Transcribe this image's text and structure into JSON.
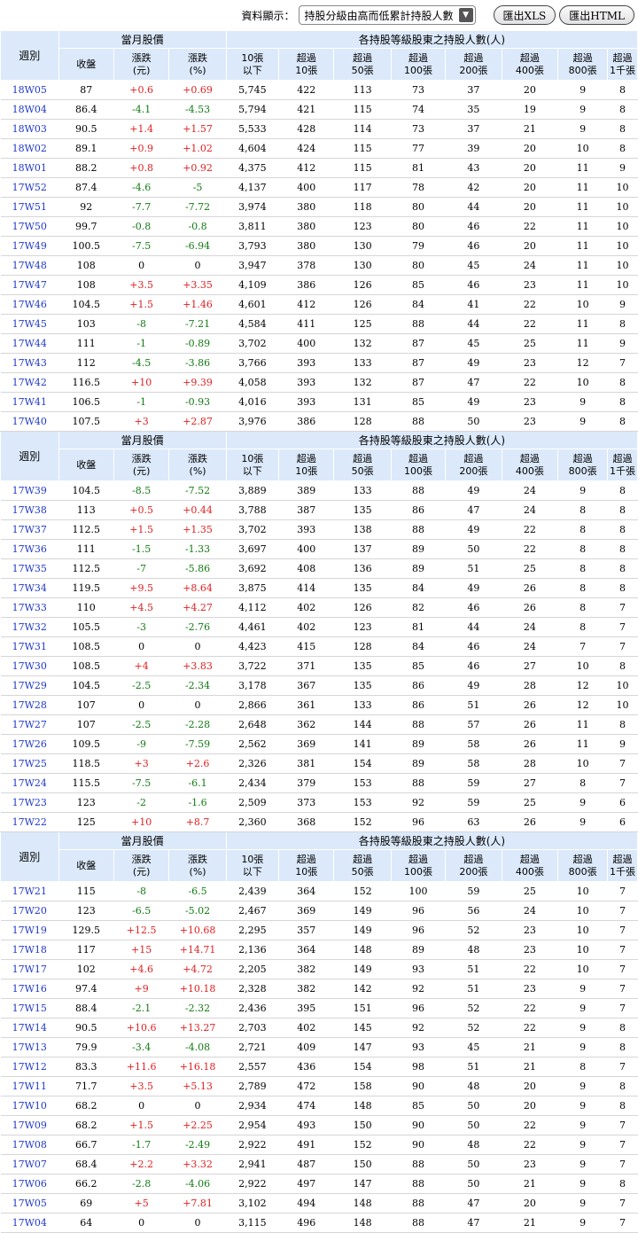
{
  "toolbar": {
    "display_label": "資料顯示：",
    "select_value": "持股分級由高而低累計持股人數",
    "export_xls": "匯出XLS",
    "export_html": "匯出HTML"
  },
  "header": {
    "week": "週別",
    "price_group": "當月股價",
    "holders_group": "各持股等級股東之持股人數(人)",
    "columns": [
      "收盤",
      "漲跌\n(元)",
      "漲跌\n(%)",
      "10張\n以下",
      "超過\n10張",
      "超過\n50張",
      "超過\n100張",
      "超過\n200張",
      "超過\n400張",
      "超過\n800張",
      "超過\n1千張"
    ]
  },
  "sections": [
    {
      "rows": [
        [
          "18W05",
          "87",
          "+0.6",
          "+0.69",
          "5,745",
          "422",
          "113",
          "73",
          "37",
          "20",
          "9",
          "8"
        ],
        [
          "18W04",
          "86.4",
          "-4.1",
          "-4.53",
          "5,794",
          "421",
          "115",
          "74",
          "35",
          "19",
          "9",
          "8"
        ],
        [
          "18W03",
          "90.5",
          "+1.4",
          "+1.57",
          "5,533",
          "428",
          "114",
          "73",
          "37",
          "21",
          "9",
          "8"
        ],
        [
          "18W02",
          "89.1",
          "+0.9",
          "+1.02",
          "4,604",
          "424",
          "115",
          "77",
          "39",
          "20",
          "10",
          "8"
        ],
        [
          "18W01",
          "88.2",
          "+0.8",
          "+0.92",
          "4,375",
          "412",
          "115",
          "81",
          "43",
          "20",
          "11",
          "9"
        ],
        [
          "17W52",
          "87.4",
          "-4.6",
          "-5",
          "4,137",
          "400",
          "117",
          "78",
          "42",
          "20",
          "11",
          "10"
        ],
        [
          "17W51",
          "92",
          "-7.7",
          "-7.72",
          "3,974",
          "380",
          "118",
          "80",
          "44",
          "20",
          "11",
          "10"
        ],
        [
          "17W50",
          "99.7",
          "-0.8",
          "-0.8",
          "3,811",
          "380",
          "123",
          "80",
          "46",
          "22",
          "11",
          "10"
        ],
        [
          "17W49",
          "100.5",
          "-7.5",
          "-6.94",
          "3,793",
          "380",
          "130",
          "79",
          "46",
          "20",
          "11",
          "10"
        ],
        [
          "17W48",
          "108",
          "0",
          "0",
          "3,947",
          "378",
          "130",
          "80",
          "45",
          "24",
          "11",
          "10"
        ],
        [
          "17W47",
          "108",
          "+3.5",
          "+3.35",
          "4,109",
          "386",
          "126",
          "85",
          "46",
          "23",
          "11",
          "10"
        ],
        [
          "17W46",
          "104.5",
          "+1.5",
          "+1.46",
          "4,601",
          "412",
          "126",
          "84",
          "41",
          "22",
          "10",
          "9"
        ],
        [
          "17W45",
          "103",
          "-8",
          "-7.21",
          "4,584",
          "411",
          "125",
          "88",
          "44",
          "22",
          "11",
          "8"
        ],
        [
          "17W44",
          "111",
          "-1",
          "-0.89",
          "3,702",
          "400",
          "132",
          "87",
          "45",
          "25",
          "11",
          "9"
        ],
        [
          "17W43",
          "112",
          "-4.5",
          "-3.86",
          "3,766",
          "393",
          "133",
          "87",
          "49",
          "23",
          "12",
          "7"
        ],
        [
          "17W42",
          "116.5",
          "+10",
          "+9.39",
          "4,058",
          "393",
          "132",
          "87",
          "47",
          "22",
          "10",
          "8"
        ],
        [
          "17W41",
          "106.5",
          "-1",
          "-0.93",
          "4,016",
          "393",
          "131",
          "85",
          "49",
          "23",
          "9",
          "8"
        ],
        [
          "17W40",
          "107.5",
          "+3",
          "+2.87",
          "3,976",
          "386",
          "128",
          "88",
          "50",
          "23",
          "9",
          "8"
        ]
      ]
    },
    {
      "rows": [
        [
          "17W39",
          "104.5",
          "-8.5",
          "-7.52",
          "3,889",
          "389",
          "133",
          "88",
          "49",
          "24",
          "9",
          "8"
        ],
        [
          "17W38",
          "113",
          "+0.5",
          "+0.44",
          "3,788",
          "387",
          "135",
          "86",
          "47",
          "24",
          "8",
          "8"
        ],
        [
          "17W37",
          "112.5",
          "+1.5",
          "+1.35",
          "3,702",
          "393",
          "138",
          "88",
          "49",
          "22",
          "8",
          "8"
        ],
        [
          "17W36",
          "111",
          "-1.5",
          "-1.33",
          "3,697",
          "400",
          "137",
          "89",
          "50",
          "22",
          "8",
          "8"
        ],
        [
          "17W35",
          "112.5",
          "-7",
          "-5.86",
          "3,692",
          "408",
          "136",
          "89",
          "51",
          "25",
          "8",
          "8"
        ],
        [
          "17W34",
          "119.5",
          "+9.5",
          "+8.64",
          "3,875",
          "414",
          "135",
          "84",
          "49",
          "26",
          "8",
          "8"
        ],
        [
          "17W33",
          "110",
          "+4.5",
          "+4.27",
          "4,112",
          "402",
          "126",
          "82",
          "46",
          "26",
          "8",
          "7"
        ],
        [
          "17W32",
          "105.5",
          "-3",
          "-2.76",
          "4,461",
          "402",
          "123",
          "81",
          "44",
          "24",
          "8",
          "7"
        ],
        [
          "17W31",
          "108.5",
          "0",
          "0",
          "4,423",
          "415",
          "128",
          "84",
          "46",
          "24",
          "7",
          "7"
        ],
        [
          "17W30",
          "108.5",
          "+4",
          "+3.83",
          "3,722",
          "371",
          "135",
          "85",
          "46",
          "27",
          "10",
          "8"
        ],
        [
          "17W29",
          "104.5",
          "-2.5",
          "-2.34",
          "3,178",
          "367",
          "135",
          "86",
          "49",
          "28",
          "12",
          "10"
        ],
        [
          "17W28",
          "107",
          "0",
          "0",
          "2,866",
          "361",
          "133",
          "86",
          "51",
          "26",
          "12",
          "10"
        ],
        [
          "17W27",
          "107",
          "-2.5",
          "-2.28",
          "2,648",
          "362",
          "144",
          "88",
          "57",
          "26",
          "11",
          "8"
        ],
        [
          "17W26",
          "109.5",
          "-9",
          "-7.59",
          "2,562",
          "369",
          "141",
          "89",
          "58",
          "26",
          "11",
          "9"
        ],
        [
          "17W25",
          "118.5",
          "+3",
          "+2.6",
          "2,326",
          "381",
          "154",
          "89",
          "58",
          "28",
          "10",
          "7"
        ],
        [
          "17W24",
          "115.5",
          "-7.5",
          "-6.1",
          "2,434",
          "379",
          "153",
          "88",
          "59",
          "27",
          "8",
          "7"
        ],
        [
          "17W23",
          "123",
          "-2",
          "-1.6",
          "2,509",
          "373",
          "153",
          "92",
          "59",
          "25",
          "9",
          "6"
        ],
        [
          "17W22",
          "125",
          "+10",
          "+8.7",
          "2,360",
          "368",
          "152",
          "96",
          "63",
          "26",
          "9",
          "6"
        ]
      ]
    },
    {
      "rows": [
        [
          "17W21",
          "115",
          "-8",
          "-6.5",
          "2,439",
          "364",
          "152",
          "100",
          "59",
          "25",
          "10",
          "7"
        ],
        [
          "17W20",
          "123",
          "-6.5",
          "-5.02",
          "2,467",
          "369",
          "149",
          "96",
          "56",
          "24",
          "10",
          "7"
        ],
        [
          "17W19",
          "129.5",
          "+12.5",
          "+10.68",
          "2,295",
          "357",
          "149",
          "96",
          "52",
          "23",
          "10",
          "7"
        ],
        [
          "17W18",
          "117",
          "+15",
          "+14.71",
          "2,136",
          "364",
          "148",
          "89",
          "48",
          "23",
          "10",
          "7"
        ],
        [
          "17W17",
          "102",
          "+4.6",
          "+4.72",
          "2,205",
          "382",
          "149",
          "93",
          "51",
          "22",
          "10",
          "7"
        ],
        [
          "17W16",
          "97.4",
          "+9",
          "+10.18",
          "2,328",
          "382",
          "142",
          "92",
          "51",
          "23",
          "9",
          "7"
        ],
        [
          "17W15",
          "88.4",
          "-2.1",
          "-2.32",
          "2,436",
          "395",
          "151",
          "96",
          "52",
          "22",
          "9",
          "7"
        ],
        [
          "17W14",
          "90.5",
          "+10.6",
          "+13.27",
          "2,703",
          "402",
          "145",
          "92",
          "52",
          "22",
          "9",
          "8"
        ],
        [
          "17W13",
          "79.9",
          "-3.4",
          "-4.08",
          "2,721",
          "409",
          "147",
          "93",
          "45",
          "21",
          "9",
          "8"
        ],
        [
          "17W12",
          "83.3",
          "+11.6",
          "+16.18",
          "2,557",
          "436",
          "154",
          "98",
          "51",
          "21",
          "8",
          "7"
        ],
        [
          "17W11",
          "71.7",
          "+3.5",
          "+5.13",
          "2,789",
          "472",
          "158",
          "90",
          "48",
          "20",
          "9",
          "8"
        ],
        [
          "17W10",
          "68.2",
          "0",
          "0",
          "2,934",
          "474",
          "148",
          "85",
          "50",
          "20",
          "9",
          "8"
        ],
        [
          "17W09",
          "68.2",
          "+1.5",
          "+2.25",
          "2,954",
          "493",
          "150",
          "90",
          "50",
          "22",
          "9",
          "7"
        ],
        [
          "17W08",
          "66.7",
          "-1.7",
          "-2.49",
          "2,922",
          "491",
          "152",
          "90",
          "48",
          "22",
          "9",
          "7"
        ],
        [
          "17W07",
          "68.4",
          "+2.2",
          "+3.32",
          "2,941",
          "487",
          "150",
          "88",
          "50",
          "23",
          "9",
          "7"
        ],
        [
          "17W06",
          "66.2",
          "-2.8",
          "-4.06",
          "2,922",
          "497",
          "147",
          "88",
          "50",
          "21",
          "9",
          "8"
        ],
        [
          "17W05",
          "69",
          "+5",
          "+7.81",
          "3,102",
          "494",
          "148",
          "88",
          "47",
          "20",
          "9",
          "7"
        ],
        [
          "17W04",
          "64",
          "0",
          "0",
          "3,115",
          "496",
          "148",
          "88",
          "47",
          "21",
          "9",
          "7"
        ]
      ]
    }
  ],
  "colors": {
    "header_bg": "#dbe9fa",
    "link": "#1f39c8",
    "up": "#e02020",
    "down": "#127a12"
  }
}
